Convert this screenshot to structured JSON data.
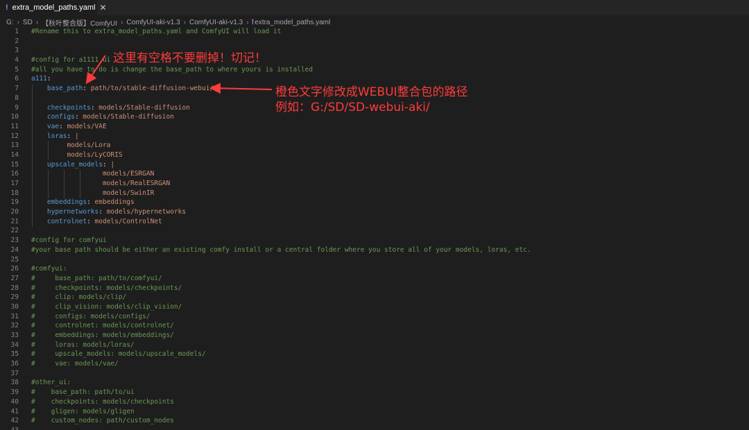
{
  "tab": {
    "icon": "yaml-icon",
    "title": "extra_model_paths.yaml",
    "close": "✕"
  },
  "breadcrumb": [
    "G:",
    "SD",
    "【秋叶整合版】ComfyUI",
    "ComfyUI-aki-v1.3",
    "ComfyUI-aki-v1.3",
    "extra_model_paths.yaml"
  ],
  "annotations": {
    "top": "这里有空格不要删掉！切记！",
    "right_line1": "橙色文字修改成WEBUI整合包的路径",
    "right_line2": "例如：G:/SD/SD-webui-aki/",
    "color": "#ff3b3b"
  },
  "lines": [
    {
      "n": "1",
      "indent": "",
      "parts": [
        [
          "c",
          "#Rename this to extra_model_paths.yaml and ComfyUI will load it"
        ]
      ]
    },
    {
      "n": "2",
      "indent": "",
      "parts": []
    },
    {
      "n": "3",
      "indent": "",
      "parts": []
    },
    {
      "n": "4",
      "indent": "",
      "parts": [
        [
          "c",
          "#config for a1111 ui"
        ]
      ]
    },
    {
      "n": "5",
      "indent": "",
      "parts": [
        [
          "c",
          "#all you have to do is change the base_path to where yours is installed"
        ]
      ]
    },
    {
      "n": "6",
      "indent": "",
      "parts": [
        [
          "k",
          "a111"
        ],
        [
          "p",
          ":"
        ]
      ]
    },
    {
      "n": "7",
      "indent": "    ",
      "parts": [
        [
          "k",
          "base_path"
        ],
        [
          "p",
          ": "
        ],
        [
          "v",
          "path/to/stable-diffusion-webui/"
        ]
      ]
    },
    {
      "n": "8",
      "indent": "",
      "parts": []
    },
    {
      "n": "9",
      "indent": "    ",
      "parts": [
        [
          "k",
          "checkpoints"
        ],
        [
          "p",
          ": "
        ],
        [
          "v",
          "models/Stable-diffusion"
        ]
      ]
    },
    {
      "n": "10",
      "indent": "    ",
      "parts": [
        [
          "k",
          "configs"
        ],
        [
          "p",
          ": "
        ],
        [
          "v",
          "models/Stable-diffusion"
        ]
      ]
    },
    {
      "n": "11",
      "indent": "    ",
      "parts": [
        [
          "k",
          "vae"
        ],
        [
          "p",
          ": "
        ],
        [
          "v",
          "models/VAE"
        ]
      ]
    },
    {
      "n": "12",
      "indent": "    ",
      "parts": [
        [
          "k",
          "loras"
        ],
        [
          "p",
          ": "
        ],
        [
          "v",
          "|"
        ]
      ]
    },
    {
      "n": "13",
      "indent": "         ",
      "parts": [
        [
          "v",
          "models/Lora"
        ]
      ]
    },
    {
      "n": "14",
      "indent": "         ",
      "parts": [
        [
          "v",
          "models/LyCORIS"
        ]
      ]
    },
    {
      "n": "15",
      "indent": "    ",
      "parts": [
        [
          "k",
          "upscale_models"
        ],
        [
          "p",
          ": "
        ],
        [
          "v",
          "|"
        ]
      ]
    },
    {
      "n": "16",
      "indent": "                  ",
      "parts": [
        [
          "v",
          "models/ESRGAN"
        ]
      ]
    },
    {
      "n": "17",
      "indent": "                  ",
      "parts": [
        [
          "v",
          "models/RealESRGAN"
        ]
      ]
    },
    {
      "n": "18",
      "indent": "                  ",
      "parts": [
        [
          "v",
          "models/SwinIR"
        ]
      ]
    },
    {
      "n": "19",
      "indent": "    ",
      "parts": [
        [
          "k",
          "embeddings"
        ],
        [
          "p",
          ": "
        ],
        [
          "v",
          "embeddings"
        ]
      ]
    },
    {
      "n": "20",
      "indent": "    ",
      "parts": [
        [
          "k",
          "hypernetworks"
        ],
        [
          "p",
          ": "
        ],
        [
          "v",
          "models/hypernetworks"
        ]
      ]
    },
    {
      "n": "21",
      "indent": "    ",
      "parts": [
        [
          "k",
          "controlnet"
        ],
        [
          "p",
          ": "
        ],
        [
          "v",
          "models/ControlNet"
        ]
      ]
    },
    {
      "n": "22",
      "indent": "",
      "parts": []
    },
    {
      "n": "23",
      "indent": "",
      "parts": [
        [
          "c",
          "#config for comfyui"
        ]
      ]
    },
    {
      "n": "24",
      "indent": "",
      "parts": [
        [
          "c",
          "#your base path should be either an existing comfy install or a central folder where you store all of your models, loras, etc."
        ]
      ]
    },
    {
      "n": "25",
      "indent": "",
      "parts": []
    },
    {
      "n": "26",
      "indent": "",
      "parts": [
        [
          "c",
          "#comfyui:"
        ]
      ]
    },
    {
      "n": "27",
      "indent": "",
      "parts": [
        [
          "c",
          "#     base_path: path/to/comfyui/"
        ]
      ]
    },
    {
      "n": "28",
      "indent": "",
      "parts": [
        [
          "c",
          "#     checkpoints: models/checkpoints/"
        ]
      ]
    },
    {
      "n": "29",
      "indent": "",
      "parts": [
        [
          "c",
          "#     clip: models/clip/"
        ]
      ]
    },
    {
      "n": "30",
      "indent": "",
      "parts": [
        [
          "c",
          "#     clip_vision: models/clip_vision/"
        ]
      ]
    },
    {
      "n": "31",
      "indent": "",
      "parts": [
        [
          "c",
          "#     configs: models/configs/"
        ]
      ]
    },
    {
      "n": "32",
      "indent": "",
      "parts": [
        [
          "c",
          "#     controlnet: models/controlnet/"
        ]
      ]
    },
    {
      "n": "33",
      "indent": "",
      "parts": [
        [
          "c",
          "#     embeddings: models/embeddings/"
        ]
      ]
    },
    {
      "n": "34",
      "indent": "",
      "parts": [
        [
          "c",
          "#     loras: models/loras/"
        ]
      ]
    },
    {
      "n": "35",
      "indent": "",
      "parts": [
        [
          "c",
          "#     upscale_models: models/upscale_models/"
        ]
      ]
    },
    {
      "n": "36",
      "indent": "",
      "parts": [
        [
          "c",
          "#     vae: models/vae/"
        ]
      ]
    },
    {
      "n": "37",
      "indent": "",
      "parts": []
    },
    {
      "n": "38",
      "indent": "",
      "parts": [
        [
          "c",
          "#other_ui:"
        ]
      ]
    },
    {
      "n": "39",
      "indent": "",
      "parts": [
        [
          "c",
          "#    base_path: path/to/ui"
        ]
      ]
    },
    {
      "n": "40",
      "indent": "",
      "parts": [
        [
          "c",
          "#    checkpoints: models/checkpoints"
        ]
      ]
    },
    {
      "n": "41",
      "indent": "",
      "parts": [
        [
          "c",
          "#    gligen: models/gligen"
        ]
      ]
    },
    {
      "n": "42",
      "indent": "",
      "parts": [
        [
          "c",
          "#    custom_nodes: path/custom_nodes"
        ]
      ]
    },
    {
      "n": "43",
      "indent": "",
      "parts": []
    }
  ]
}
